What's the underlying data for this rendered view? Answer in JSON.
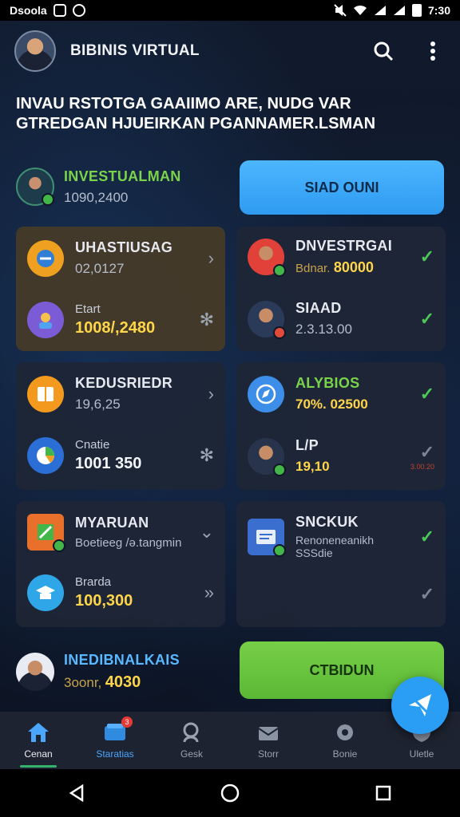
{
  "status_bar": {
    "left_text": "Dsoola",
    "time": "7:30"
  },
  "appbar": {
    "title": "BIBINIS VIRTUAL"
  },
  "headline": {
    "line1": "INVAU RSTOTGA GAAIIMO ARE, NUDG VAR",
    "line2": "GTREDGAN HJUEIRKAN PGANNAMER.LSMAN"
  },
  "row1": {
    "title": "INVESTUALMAN",
    "value": "1090,2400",
    "button_label": "SIAD OUNI"
  },
  "left_panels": [
    {
      "top": {
        "title": "UHASTIUSAG",
        "sub": "02,0127"
      },
      "bottom": {
        "label": "Etart",
        "value": "1008/,2480"
      }
    },
    {
      "top": {
        "title": "KEDUSRIEDR",
        "sub": "19,6,25"
      },
      "bottom": {
        "label": "Cnatie",
        "value": "1001 350"
      }
    },
    {
      "top": {
        "title": "MYARUAN",
        "sub": "Boetieeg /ə.tangmin"
      },
      "bottom": {
        "label": "Brarda",
        "value": "100,300"
      }
    }
  ],
  "right_panels": [
    {
      "top": {
        "title": "DNVESTRGAI",
        "sub_label": "Bdnar.",
        "sub_value": "80000"
      },
      "bottom": {
        "title": "SIAAD",
        "sub": "2.3.13.00"
      }
    },
    {
      "top": {
        "title": "ALYBIOS",
        "sub": "70%. 02500"
      },
      "bottom": {
        "title": "L/P",
        "sub": "19,10",
        "tag": "3.00.20"
      }
    },
    {
      "top": {
        "title": "SNCKUK",
        "sub": "Renoneneanikh",
        "sub2": "SSSdie"
      }
    }
  ],
  "last_row": {
    "title": "INEDIBNALKAIS",
    "sub_label": "3oonr,",
    "sub_value": "4030",
    "button_label": "CTBIDUN"
  },
  "bottom_nav": [
    {
      "label": "Cenan",
      "icon": "home-icon"
    },
    {
      "label": "Staratias",
      "icon": "wallet-icon",
      "badge": "3"
    },
    {
      "label": "Gesk",
      "icon": "search-user-icon"
    },
    {
      "label": "Storr",
      "icon": "mail-icon"
    },
    {
      "label": "Bonie",
      "icon": "gear-icon"
    },
    {
      "label": "Uletle",
      "icon": "shield-icon"
    }
  ],
  "colors": {
    "accent_blue": "#2f9bf0",
    "accent_green": "#5bb836",
    "bg": "#0f1626"
  }
}
